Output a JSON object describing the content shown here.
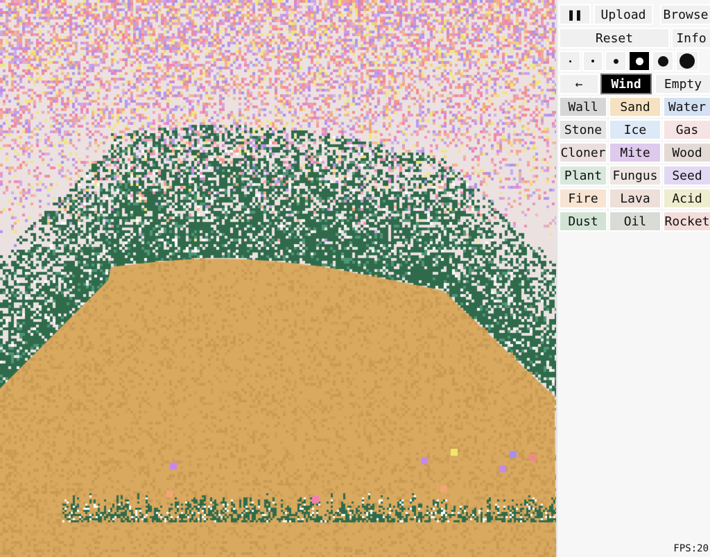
{
  "toolbar": {
    "pause_label": "❚❚",
    "upload_label": "Upload",
    "browse_label": "Browse",
    "reset_label": "Reset",
    "info_label": "Info"
  },
  "brush_sizes": {
    "count": 6,
    "selected_index": 3
  },
  "tools": {
    "back_label": "←",
    "wind_label": "Wind",
    "empty_label": "Empty"
  },
  "elements": [
    {
      "label": "Wall",
      "color": "#d6d6d6"
    },
    {
      "label": "Sand",
      "color": "#f6e2c0"
    },
    {
      "label": "Water",
      "color": "#d3e1f3"
    },
    {
      "label": "Stone",
      "color": "#e4e4e4"
    },
    {
      "label": "Ice",
      "color": "#dde9f6"
    },
    {
      "label": "Gas",
      "color": "#f6e3e3"
    },
    {
      "label": "Cloner",
      "color": "#eadede"
    },
    {
      "label": "Mite",
      "color": "#dfc9ec"
    },
    {
      "label": "Wood",
      "color": "#e3dad6"
    },
    {
      "label": "Plant",
      "color": "#d8e8dd"
    },
    {
      "label": "Fungus",
      "color": "#ede6e2"
    },
    {
      "label": "Seed",
      "color": "#e2d8f3"
    },
    {
      "label": "Fire",
      "color": "#f8e4d3"
    },
    {
      "label": "Lava",
      "color": "#eedfd9"
    },
    {
      "label": "Acid",
      "color": "#eeedcd"
    },
    {
      "label": "Dust",
      "color": "#d1e3d5"
    },
    {
      "label": "Oil",
      "color": "#d9dbd6"
    },
    {
      "label": "Rocket",
      "color": "#f3dcda"
    }
  ],
  "status": {
    "fps_text": "FPS:20"
  },
  "colors": {
    "sand": "#d8a95f",
    "sand_dark": "#c99a52",
    "plant": "#2f6b4b",
    "plant_light": "#4f9577",
    "sky": "#ece1e1",
    "pink": "#f080b0",
    "salmon": "#f2888e",
    "violet": "#c48ae8",
    "lavender": "#a58ff0",
    "yellow": "#f2e66a",
    "orange": "#f3a574"
  }
}
